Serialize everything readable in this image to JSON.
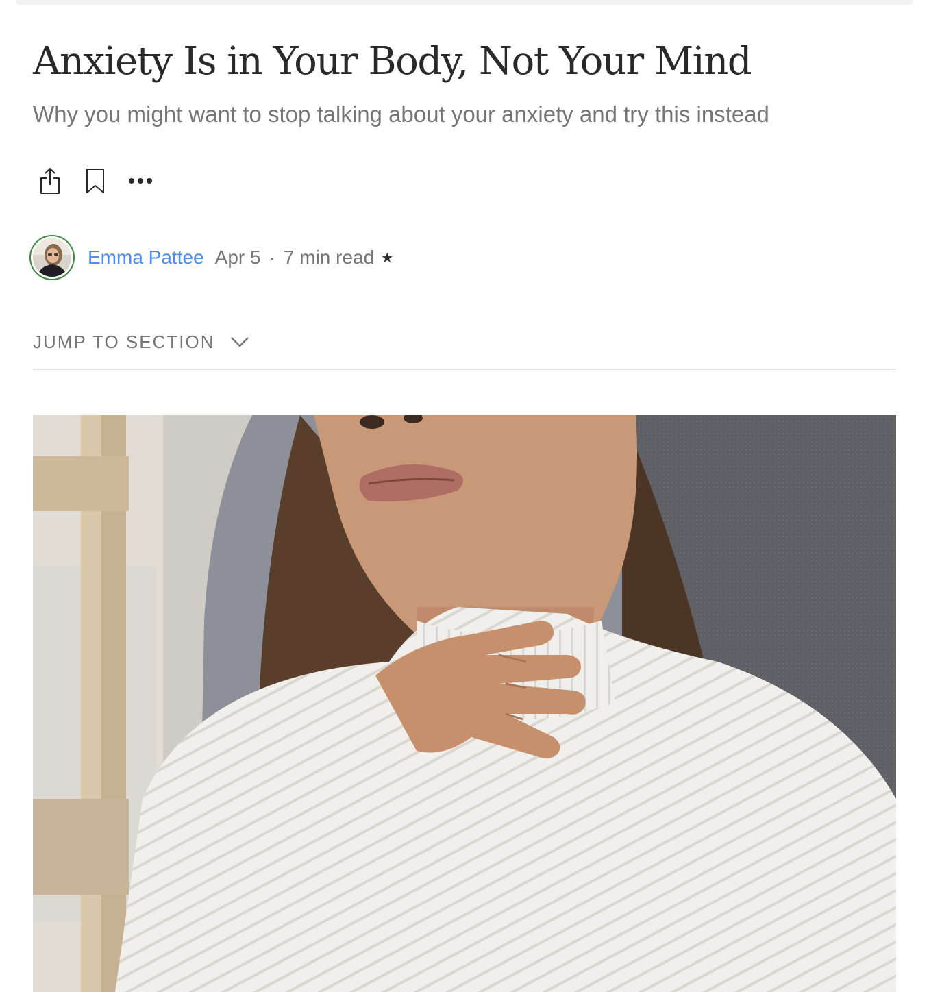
{
  "article": {
    "title": "Anxiety Is in Your Body, Not Your Mind",
    "subtitle": "Why you might want to stop talking about your anxiety and try this instead"
  },
  "actions": {
    "share_icon": "share-icon",
    "bookmark_icon": "bookmark-icon",
    "more_icon": "more-options-icon"
  },
  "byline": {
    "author": "Emma Pattee",
    "date": "Apr 5",
    "separator": "·",
    "read_time": "7 min read",
    "member_star": "★"
  },
  "jump_to_section": {
    "label": "JUMP TO SECTION"
  },
  "colors": {
    "author_link": "#4a8cf7",
    "title": "#292929",
    "muted": "#757575",
    "avatar_ring": "#3a8a3a"
  }
}
